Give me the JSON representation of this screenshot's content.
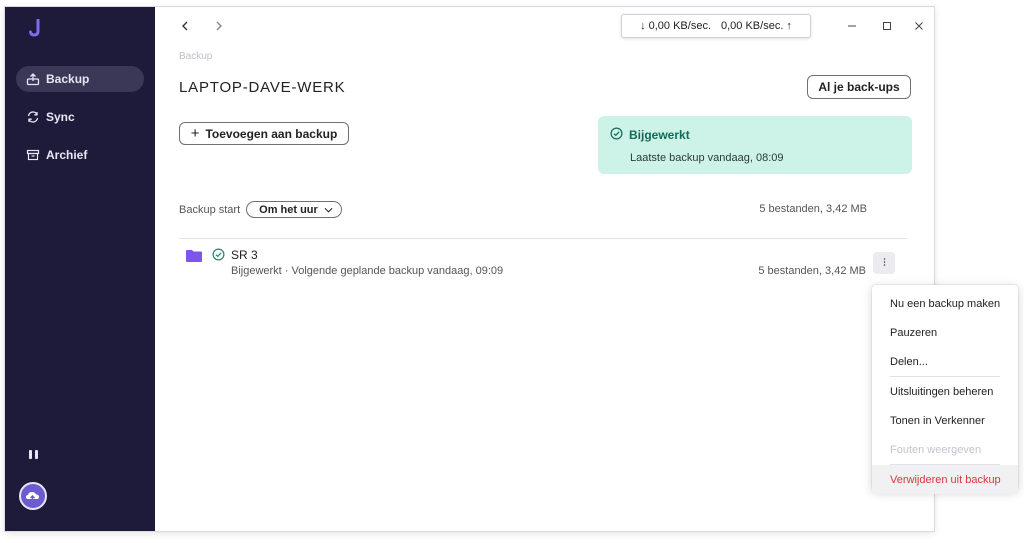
{
  "sidebar": {
    "items": [
      {
        "label": "Backup",
        "icon": "backup-icon",
        "active": true
      },
      {
        "label": "Sync",
        "icon": "sync-icon",
        "active": false
      },
      {
        "label": "Archief",
        "icon": "archive-icon",
        "active": false
      }
    ]
  },
  "toolbar": {
    "download_speed": "0,00 KB/sec.",
    "upload_speed": "0,00 KB/sec."
  },
  "main": {
    "breadcrumb": "Backup",
    "title": "LAPTOP-DAVE-WERK",
    "all_backups_label": "Al je back-ups",
    "add_label": "Toevoegen aan backup",
    "status": {
      "title": "Bijgewerkt",
      "subtitle": "Laatste backup vandaag, 08:09"
    },
    "schedule": {
      "label": "Backup start",
      "value": "Om het uur"
    },
    "total_count": "5 bestanden,  3,42 MB",
    "folder": {
      "name": "SR 3",
      "meta": "Bijgewerkt · Volgende geplande backup vandaag, 09:09",
      "count": "5 bestanden,  3,42 MB"
    }
  },
  "context_menu": {
    "items": [
      {
        "label": "Nu een backup maken"
      },
      {
        "label": "Pauzeren"
      },
      {
        "label": "Delen..."
      },
      {
        "label": "Uitsluitingen beheren"
      },
      {
        "label": "Tonen in Verkenner"
      },
      {
        "label": "Fouten weergeven"
      },
      {
        "label": "Verwijderen uit backup"
      }
    ]
  },
  "colors": {
    "sidebar_bg": "#1e1b3a",
    "accent": "#6d5bd0",
    "status_bg": "#cdf3e8",
    "status_text": "#116b55",
    "danger": "#d13a3a"
  }
}
